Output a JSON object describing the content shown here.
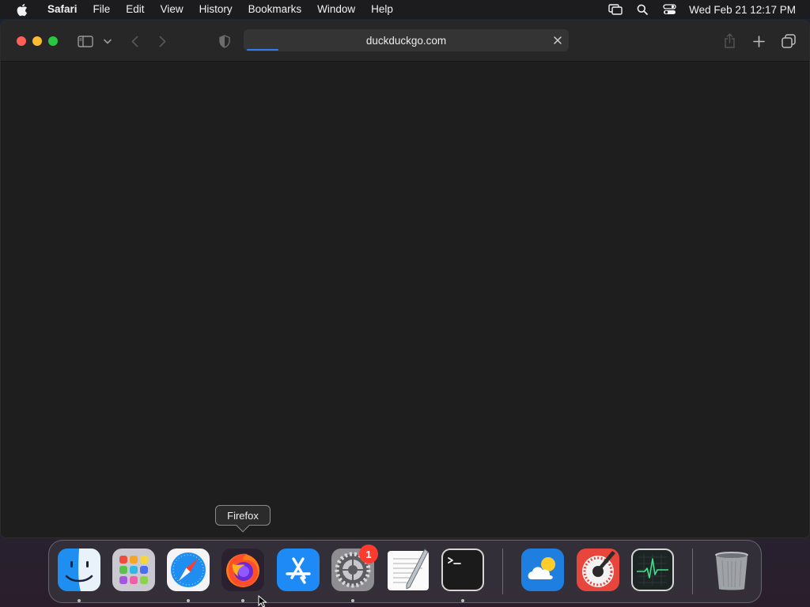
{
  "menubar": {
    "apple_icon": "apple-logo-icon",
    "app_name": "Safari",
    "items": [
      "File",
      "Edit",
      "View",
      "History",
      "Bookmarks",
      "Window",
      "Help"
    ],
    "status_icons": [
      "screen-mirroring-icon",
      "spotlight-search-icon",
      "control-center-icon"
    ],
    "clock": "Wed Feb 21  12:17 PM"
  },
  "browser": {
    "address": "duckduckgo.com",
    "loading": true,
    "loading_progress": 0.1
  },
  "tooltip": {
    "text": "Firefox"
  },
  "dock": {
    "apps": [
      {
        "name": "Finder",
        "icon": "finder-icon",
        "running": true
      },
      {
        "name": "Launchpad",
        "icon": "launchpad-icon",
        "running": false
      },
      {
        "name": "Safari",
        "icon": "safari-icon",
        "running": true
      },
      {
        "name": "Firefox",
        "icon": "firefox-icon",
        "running": true
      },
      {
        "name": "App Store",
        "icon": "app-store-icon",
        "running": false
      },
      {
        "name": "System Settings",
        "icon": "system-settings-icon",
        "running": true,
        "badge": "1"
      },
      {
        "name": "TextEdit",
        "icon": "textedit-icon",
        "running": false
      },
      {
        "name": "Terminal",
        "icon": "terminal-icon",
        "running": true
      },
      {
        "name": "Weather",
        "icon": "weather-icon",
        "running": false
      },
      {
        "name": "Digital Color Meter",
        "icon": "color-meter-icon",
        "running": false
      },
      {
        "name": "Activity Monitor",
        "icon": "activity-monitor-icon",
        "running": false
      },
      {
        "name": "Trash",
        "icon": "trash-icon",
        "running": false
      }
    ]
  },
  "colors": {
    "accent": "#2f7cf6",
    "close": "#ff5f57",
    "minimize": "#febc2e",
    "zoom": "#28c840",
    "badge": "#ff3b30"
  }
}
